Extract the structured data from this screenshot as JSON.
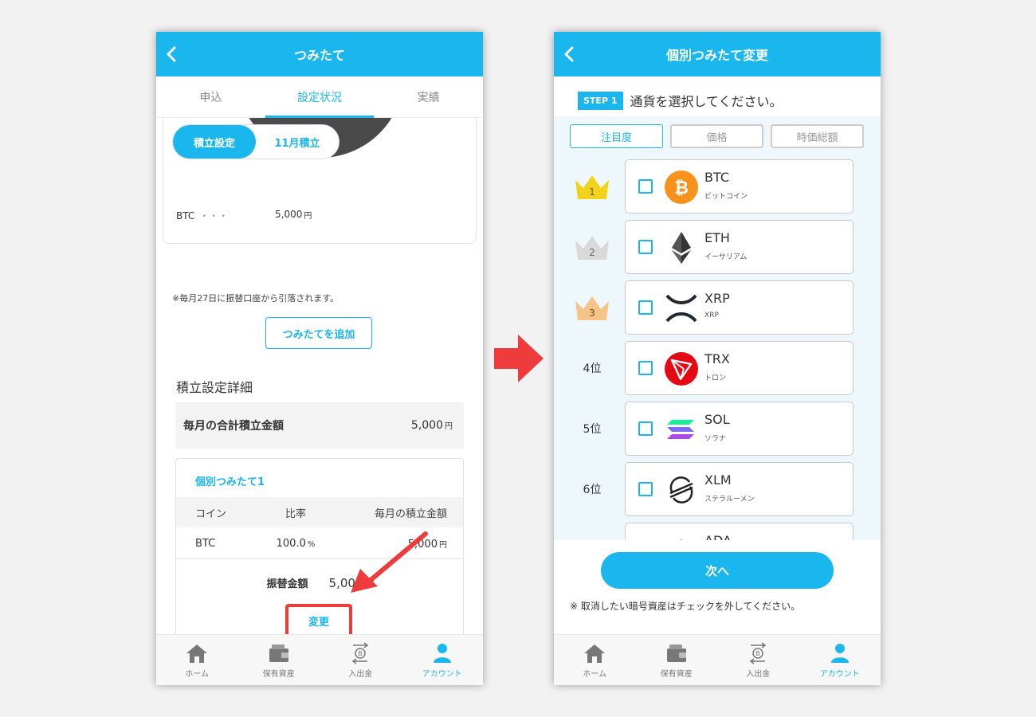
{
  "left": {
    "header_title": "つみたて",
    "tabs": [
      "申込",
      "設定状況",
      "実績"
    ],
    "active_tab_index": 1,
    "segment": [
      "積立設定",
      "11月積立"
    ],
    "legend": {
      "coin": "BTC",
      "dots": "・・・",
      "amount": "5,000",
      "unit": "円"
    },
    "note": "※毎月27日に振替口座から引落されます。",
    "add_button": "つみたてを追加",
    "section_title": "積立設定詳細",
    "total": {
      "label": "毎月の合計積立金額",
      "amount": "5,000",
      "unit": "円"
    },
    "detail": {
      "title": "個別つみたて1",
      "headers": [
        "コイン",
        "比率",
        "毎月の積立金額"
      ],
      "row": {
        "coin": "BTC",
        "ratio": "100.0",
        "ratio_unit": "%",
        "amount": "5,000",
        "amount_unit": "円"
      },
      "transfer_label": "振替金額",
      "transfer_amount": "5,000",
      "transfer_unit": "円",
      "change_button": "変更"
    }
  },
  "right": {
    "header_title": "個別つみたて変更",
    "step_badge": "STEP 1",
    "step_text": "通貨を選択してください。",
    "sort_tabs": [
      "注目度",
      "価格",
      "時価総額"
    ],
    "coins": [
      {
        "rank": "1",
        "symbol": "BTC",
        "name": "ビットコイン",
        "icon": "bitcoin-icon"
      },
      {
        "rank": "2",
        "symbol": "ETH",
        "name": "イーサリアム",
        "icon": "ethereum-icon"
      },
      {
        "rank": "3",
        "symbol": "XRP",
        "name": "XRP",
        "icon": "xrp-icon"
      },
      {
        "rank": "4位",
        "symbol": "TRX",
        "name": "トロン",
        "icon": "tron-icon"
      },
      {
        "rank": "5位",
        "symbol": "SOL",
        "name": "ソラナ",
        "icon": "solana-icon"
      },
      {
        "rank": "6位",
        "symbol": "XLM",
        "name": "ステラルーメン",
        "icon": "stellar-icon"
      },
      {
        "rank": "",
        "symbol": "ADA",
        "name": "",
        "icon": "cardano-icon"
      }
    ],
    "next_button": "次へ",
    "bottom_note": "※ 取消したい暗号資産はチェックを外してください。"
  },
  "nav": [
    "ホーム",
    "保有資産",
    "入出金",
    "アカウント"
  ],
  "colors": {
    "brand": "#1ab7ef",
    "highlight": "#ee3b3b",
    "gold": "#f3d21b",
    "silver": "#d9d9d9",
    "bronze": "#f5c488"
  }
}
